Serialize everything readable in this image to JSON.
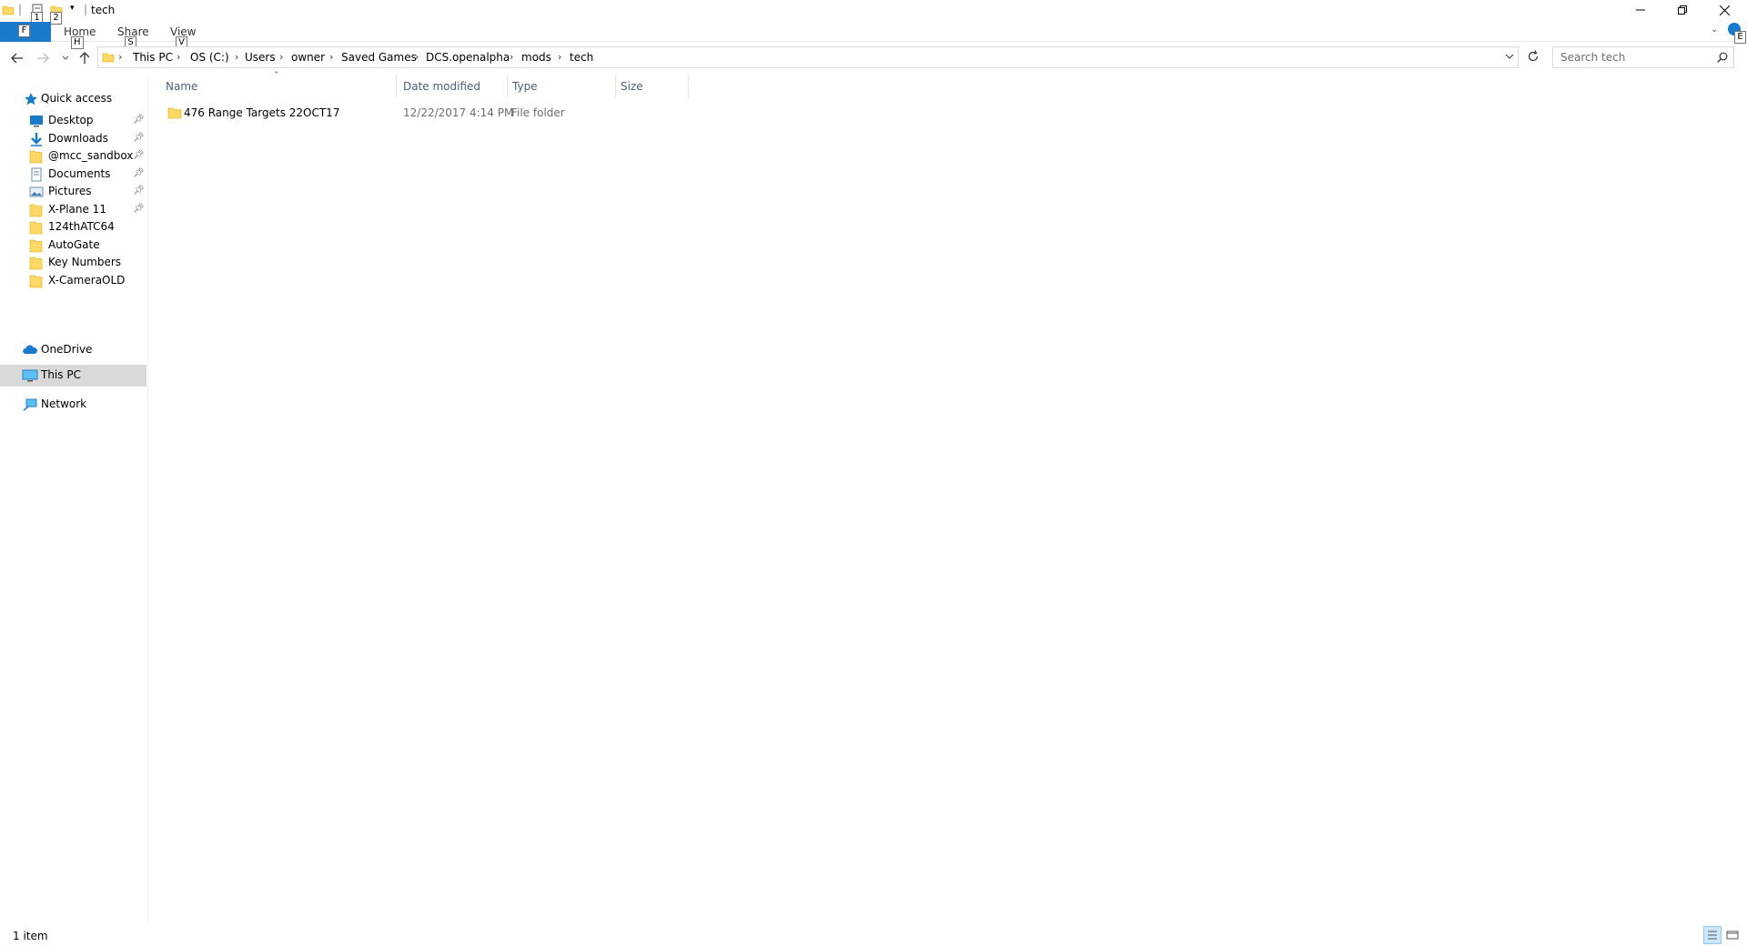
{
  "window": {
    "title": "tech",
    "quick_access_keytips": [
      "1",
      "2"
    ]
  },
  "ribbon": {
    "file_keytip": "F",
    "tabs": [
      {
        "label": "Home",
        "keytip": "H"
      },
      {
        "label": "Share",
        "keytip": "S"
      },
      {
        "label": "View",
        "keytip": "V"
      }
    ],
    "help_keytip": "E"
  },
  "address": {
    "crumbs": [
      "This PC",
      "OS (C:)",
      "Users",
      "owner",
      "Saved Games",
      "DCS.openalpha",
      "mods",
      "tech"
    ]
  },
  "search": {
    "placeholder": "Search tech"
  },
  "navpane": {
    "quick_access": "Quick access",
    "pinned": [
      {
        "label": "Desktop",
        "icon": "desktop-icon",
        "pinned": true
      },
      {
        "label": "Downloads",
        "icon": "downloads-icon",
        "pinned": true
      },
      {
        "label": "@mcc_sandbox",
        "icon": "folder-icon",
        "pinned": true
      },
      {
        "label": "Documents",
        "icon": "documents-icon",
        "pinned": true
      },
      {
        "label": "Pictures",
        "icon": "pictures-icon",
        "pinned": true
      },
      {
        "label": "X-Plane 11",
        "icon": "folder-icon",
        "pinned": true
      },
      {
        "label": "124thATC64",
        "icon": "folder-icon",
        "pinned": false
      },
      {
        "label": "AutoGate",
        "icon": "folder-icon",
        "pinned": false
      },
      {
        "label": "Key Numbers",
        "icon": "folder-icon",
        "pinned": false
      },
      {
        "label": "X-CameraOLD",
        "icon": "folder-icon",
        "pinned": false
      }
    ],
    "onedrive": "OneDrive",
    "thispc": "This PC",
    "network": "Network"
  },
  "columns": {
    "name": "Name",
    "date": "Date modified",
    "type": "Type",
    "size": "Size"
  },
  "files": [
    {
      "name": "476 Range Targets 22OCT17",
      "date": "12/22/2017 4:14 PM",
      "type": "File folder",
      "size": ""
    }
  ],
  "status": {
    "count": "1 item"
  },
  "colors": {
    "accent": "#1979ca",
    "folder": "#ffd866",
    "selected": "#d9d9d9"
  }
}
